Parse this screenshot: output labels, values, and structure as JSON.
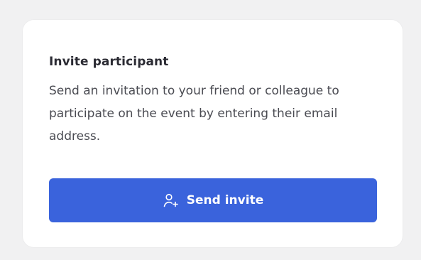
{
  "card": {
    "title": "Invite participant",
    "description": "Send an invitation to your friend or colleague to participate on the event by entering their email address.",
    "button": {
      "label": "Send invite",
      "icon": "add-user-icon"
    }
  },
  "colors": {
    "page_background": "#f1f1f2",
    "card_background": "#ffffff",
    "button_background": "#3a63dc",
    "button_text": "#ffffff",
    "title_text": "#2b2b33",
    "body_text": "#4a4b52"
  }
}
